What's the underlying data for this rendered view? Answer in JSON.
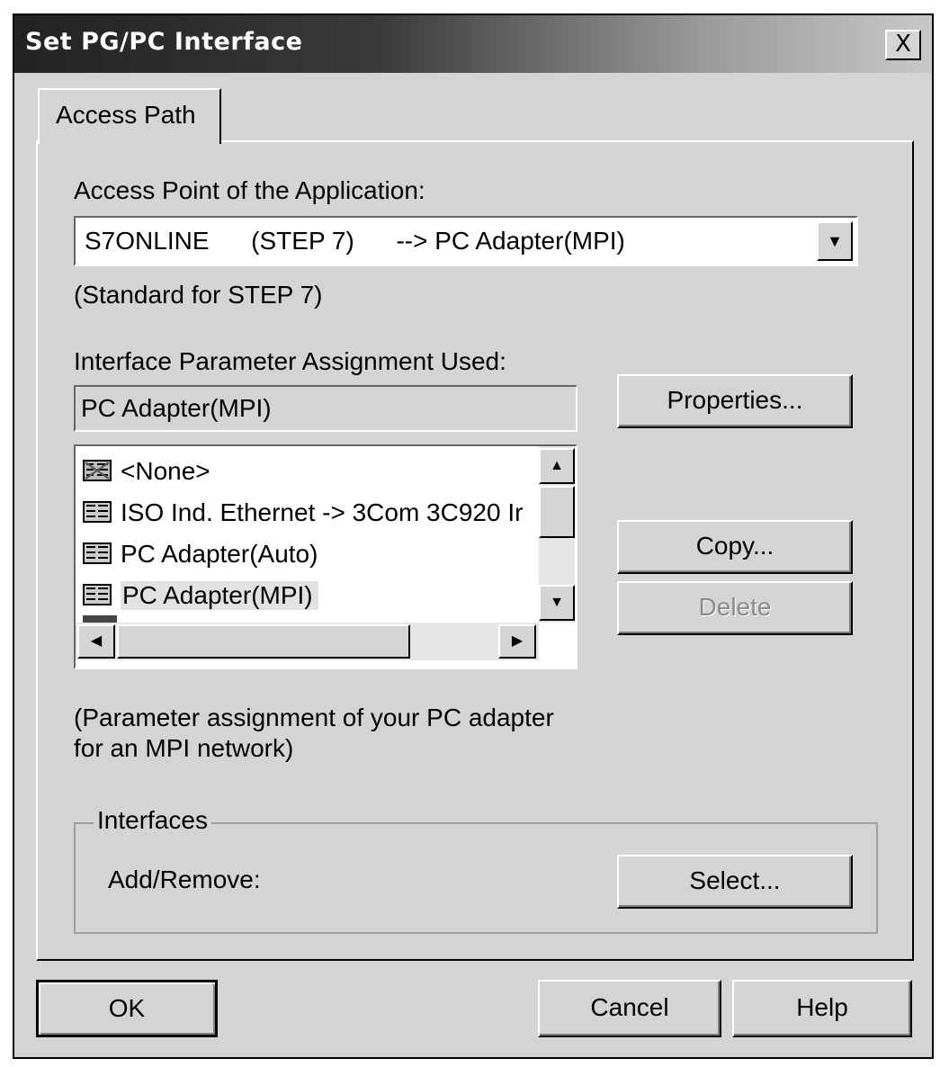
{
  "window": {
    "title": "Set PG/PC Interface",
    "close_glyph": "X"
  },
  "tabs": [
    {
      "label": "Access Path"
    }
  ],
  "access_point": {
    "label": "Access Point of the Application:",
    "value": "S7ONLINE      (STEP 7)      --> PC Adapter(MPI)",
    "description": "(Standard for STEP 7)"
  },
  "interface_param": {
    "label": "Interface Parameter Assignment Used:",
    "value": "PC Adapter(MPI)",
    "items": [
      {
        "label": "<None>",
        "icon": "network-none-icon"
      },
      {
        "label": "ISO Ind. Ethernet -> 3Com 3C920 Ir",
        "icon": "network-card-icon"
      },
      {
        "label": "PC Adapter(Auto)",
        "icon": "network-card-icon"
      },
      {
        "label": "PC Adapter(MPI)",
        "icon": "network-card-icon",
        "selected": true
      }
    ],
    "description_line1": "(Parameter assignment of your PC adapter",
    "description_line2": "for an MPI network)"
  },
  "buttons": {
    "properties": "Properties...",
    "copy": "Copy...",
    "delete": "Delete",
    "ok": "OK",
    "cancel": "Cancel",
    "help": "Help"
  },
  "interfaces": {
    "legend": "Interfaces",
    "add_remove_label": "Add/Remove:",
    "select_button": "Select..."
  }
}
